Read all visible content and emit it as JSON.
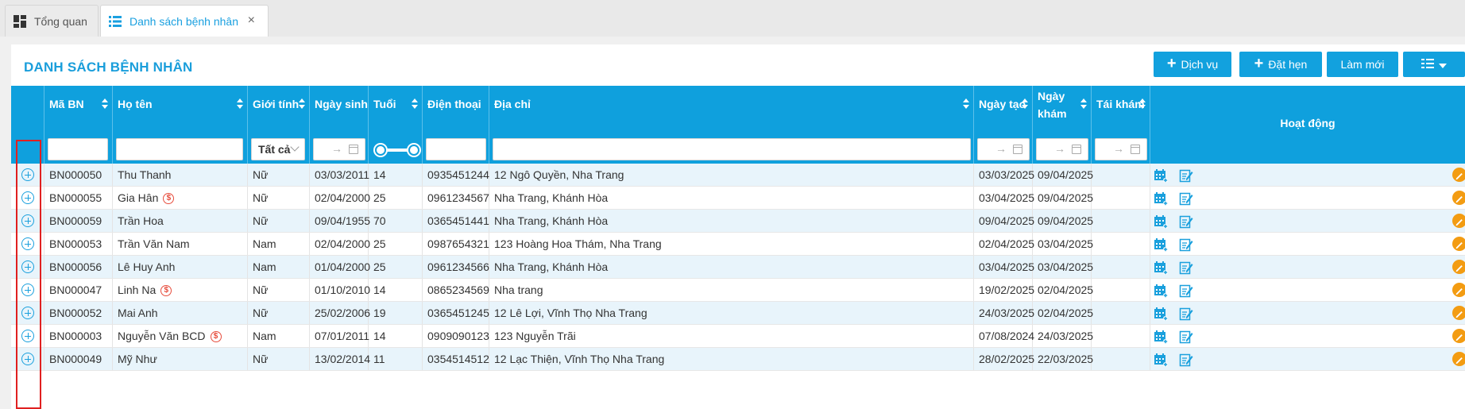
{
  "tabs": [
    {
      "label": "Tổng quan",
      "icon": "dashboard-icon"
    },
    {
      "label": "Danh sách bệnh nhân",
      "icon": "list-icon",
      "close": "×"
    }
  ],
  "page": {
    "title": "DANH SÁCH BỆNH NHÂN",
    "buttons": {
      "service": "Dịch vụ",
      "booking": "Đặt hẹn",
      "refresh": "Làm mới",
      "plus": "+"
    }
  },
  "table": {
    "headers": {
      "code": "Mã BN",
      "name": "Họ tên",
      "gender": "Giới tính",
      "dob": "Ngày sinh",
      "age": "Tuổi",
      "phone": "Điện thoại",
      "address": "Địa chỉ",
      "created": "Ngày tạo",
      "visit": "Ngày khám",
      "revisit": "Tái khám",
      "actions": "Hoạt động"
    },
    "filters": {
      "gender_selected": "Tất cả",
      "range_arrow": "→"
    },
    "debt_symbol": "$",
    "rows": [
      {
        "code": "BN000050",
        "name": "Thu Thanh",
        "debt": false,
        "gender": "Nữ",
        "dob": "03/03/2011",
        "age": "14",
        "phone": "0935451244",
        "address": "12 Ngô Quyền, Nha Trang",
        "created": "03/03/2025",
        "visit": "09/04/2025",
        "revisit": ""
      },
      {
        "code": "BN000055",
        "name": "Gia Hân",
        "debt": true,
        "gender": "Nữ",
        "dob": "02/04/2000",
        "age": "25",
        "phone": "0961234567",
        "address": "Nha Trang, Khánh Hòa",
        "created": "03/04/2025",
        "visit": "09/04/2025",
        "revisit": ""
      },
      {
        "code": "BN000059",
        "name": "Trần Hoa",
        "debt": false,
        "gender": "Nữ",
        "dob": "09/04/1955",
        "age": "70",
        "phone": "0365451441",
        "address": "Nha Trang, Khánh Hòa",
        "created": "09/04/2025",
        "visit": "09/04/2025",
        "revisit": ""
      },
      {
        "code": "BN000053",
        "name": "Trần Văn Nam",
        "debt": false,
        "gender": "Nam",
        "dob": "02/04/2000",
        "age": "25",
        "phone": "0987654321",
        "address": "123 Hoàng Hoa Thám, Nha Trang",
        "created": "02/04/2025",
        "visit": "03/04/2025",
        "revisit": ""
      },
      {
        "code": "BN000056",
        "name": "Lê Huy Anh",
        "debt": false,
        "gender": "Nam",
        "dob": "01/04/2000",
        "age": "25",
        "phone": "0961234566",
        "address": "Nha Trang, Khánh Hòa",
        "created": "03/04/2025",
        "visit": "03/04/2025",
        "revisit": ""
      },
      {
        "code": "BN000047",
        "name": "Linh Na",
        "debt": true,
        "gender": "Nữ",
        "dob": "01/10/2010",
        "age": "14",
        "phone": "0865234569",
        "address": "Nha trang",
        "created": "19/02/2025",
        "visit": "02/04/2025",
        "revisit": ""
      },
      {
        "code": "BN000052",
        "name": "Mai Anh",
        "debt": false,
        "gender": "Nữ",
        "dob": "25/02/2006",
        "age": "19",
        "phone": "0365451245",
        "address": "12 Lê Lợi, Vĩnh Thọ Nha Trang",
        "created": "24/03/2025",
        "visit": "02/04/2025",
        "revisit": ""
      },
      {
        "code": "BN000003",
        "name": "Nguyễn Văn BCD",
        "debt": true,
        "gender": "Nam",
        "dob": "07/01/2011",
        "age": "14",
        "phone": "0909090123",
        "address": "123 Nguyễn Trãi",
        "created": "07/08/2024",
        "visit": "24/03/2025",
        "revisit": ""
      },
      {
        "code": "BN000049",
        "name": "Mỹ Như",
        "debt": false,
        "gender": "Nữ",
        "dob": "13/02/2014",
        "age": "11",
        "phone": "0354514512",
        "address": "12 Lạc Thiện, Vĩnh Thọ Nha Trang",
        "created": "28/02/2025",
        "visit": "22/03/2025",
        "revisit": ""
      }
    ]
  },
  "colors": {
    "accent": "#0fa0dd",
    "row_alt": "#e8f4fb",
    "highlight": "#e02020",
    "debt_icon": "#e74c3c",
    "edit_button": "#f39c12"
  }
}
